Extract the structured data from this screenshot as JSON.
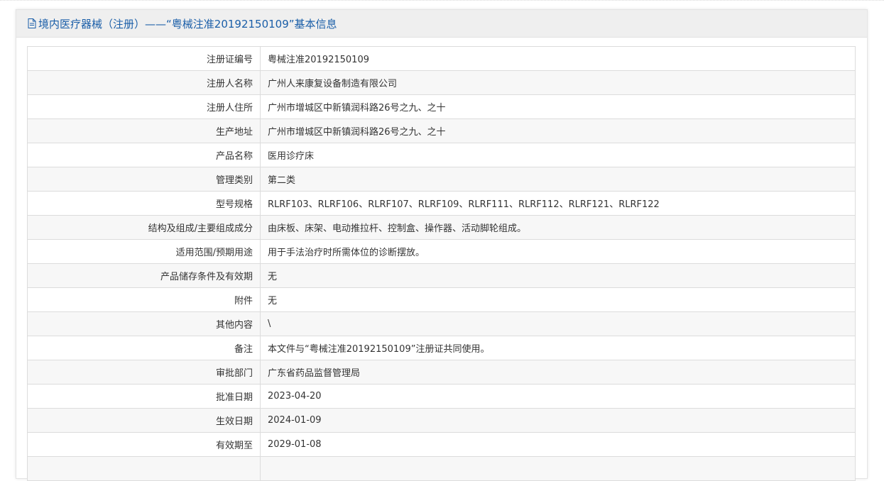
{
  "header": {
    "icon": "document-icon",
    "title": "境内医疗器械（注册）——“粤械注准20192150109”基本信息"
  },
  "rows": [
    {
      "label": "注册证编号",
      "value": "粤械注准20192150109"
    },
    {
      "label": "注册人名称",
      "value": "广州人来康复设备制造有限公司"
    },
    {
      "label": "注册人住所",
      "value": "广州市增城区中新镇润科路26号之九、之十"
    },
    {
      "label": "生产地址",
      "value": "广州市增城区中新镇润科路26号之九、之十"
    },
    {
      "label": "产品名称",
      "value": "医用诊疗床"
    },
    {
      "label": "管理类别",
      "value": "第二类"
    },
    {
      "label": "型号规格",
      "value": "RLRF103、RLRF106、RLRF107、RLRF109、RLRF111、RLRF112、RLRF121、RLRF122"
    },
    {
      "label": "结构及组成/主要组成成分",
      "value": "由床板、床架、电动推拉杆、控制盒、操作器、活动脚轮组成。"
    },
    {
      "label": "适用范围/预期用途",
      "value": "用于手法治疗时所需体位的诊断摆放。"
    },
    {
      "label": "产品储存条件及有效期",
      "value": "无"
    },
    {
      "label": "附件",
      "value": "无"
    },
    {
      "label": "其他内容",
      "value": "\\"
    },
    {
      "label": "备注",
      "value": "本文件与“粤械注准20192150109”注册证共同使用。"
    },
    {
      "label": "审批部门",
      "value": "广东省药品监督管理局"
    },
    {
      "label": "批准日期",
      "value": "2023-04-20"
    },
    {
      "label": "生效日期",
      "value": "2024-01-09"
    },
    {
      "label": "有效期至",
      "value": "2029-01-08"
    },
    {
      "label": "",
      "value": ""
    }
  ]
}
